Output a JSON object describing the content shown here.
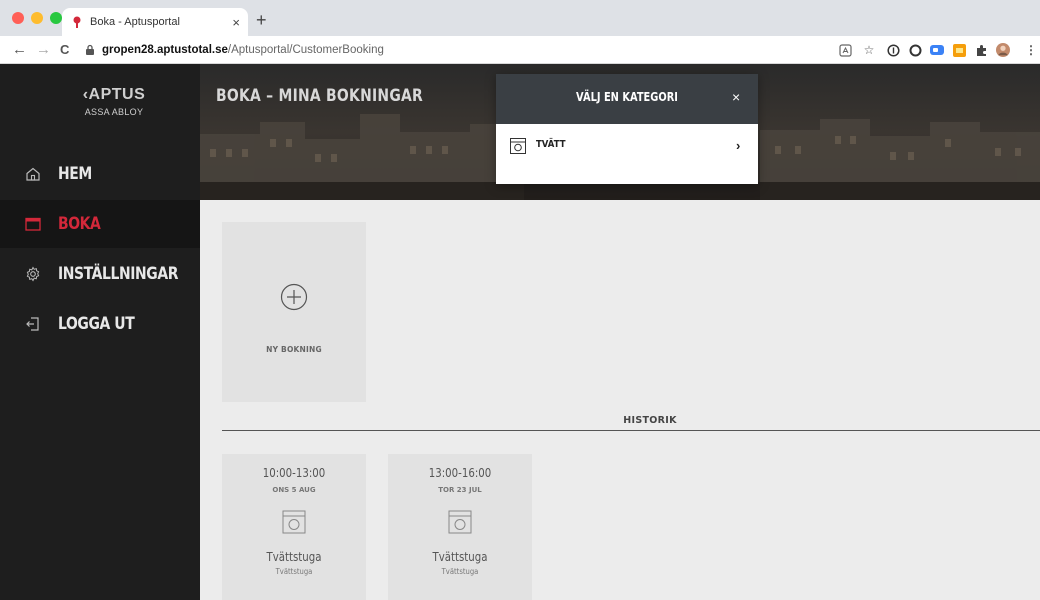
{
  "browser": {
    "tab_title": "Boka - Aptusportal",
    "tab_close": "×",
    "new_tab": "+",
    "url_host": "gropen28.aptustotal.se",
    "url_path": "/Aptusportal/CustomerBooking",
    "back": "←",
    "forward": "→",
    "reload": "C",
    "star": "☆",
    "menu": "⋮"
  },
  "logo": {
    "line1": "‹APTUS",
    "line2": "ASSA ABLOY"
  },
  "sidebar": {
    "items": [
      {
        "label": "HEM",
        "icon": "home-icon",
        "active": false
      },
      {
        "label": "BOKA",
        "icon": "calendar-icon",
        "active": true
      },
      {
        "label": "INSTÄLLNINGAR",
        "icon": "gear-icon",
        "active": false
      },
      {
        "label": "LOGGA UT",
        "icon": "logout-icon",
        "active": false
      }
    ]
  },
  "header": {
    "title": "BOKA – MINA BOKNINGAR"
  },
  "main": {
    "new_booking_label": "NY BOKNING",
    "history_title": "HISTORIK",
    "bookings": [
      {
        "time": "10:00-13:00",
        "date": "ONS 5 AUG",
        "name": "Tvättstuga",
        "sub": "Tvättstuga"
      },
      {
        "time": "13:00-16:00",
        "date": "TOR 23 JUL",
        "name": "Tvättstuga",
        "sub": "Tvättstuga"
      }
    ]
  },
  "modal": {
    "title": "VÄLJ EN KATEGORI",
    "close": "×",
    "categories": [
      {
        "label": "TVÄTT",
        "icon": "washing-machine-icon",
        "chevron": "›"
      }
    ]
  },
  "colors": {
    "accent": "#d3283a",
    "sidebar_bg": "#1e1e1e",
    "modal_head": "#3a3f44",
    "main_bg": "#ececec"
  }
}
